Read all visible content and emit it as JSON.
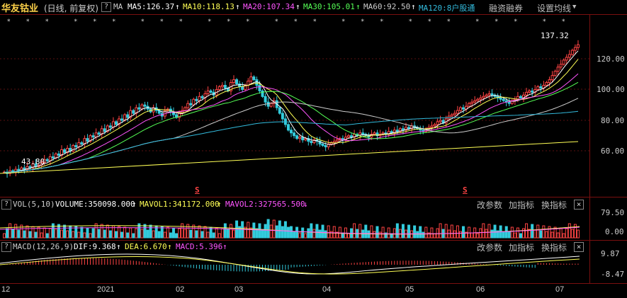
{
  "header": {
    "stock_name": "华友钴业",
    "period": "(日线, 前复权)",
    "help": "?",
    "ma_label": "MA",
    "ma5": {
      "text": "MA5:126.37",
      "color": "#ffffff"
    },
    "ma10": {
      "text": "MA10:118.13",
      "color": "#ffff55"
    },
    "ma20": {
      "text": "MA20:107.34",
      "color": "#ff55ff"
    },
    "ma30": {
      "text": "MA30:105.01",
      "color": "#55ff55"
    },
    "ma60": {
      "text": "MA60:92.50",
      "color": "#cccccc"
    },
    "ma120": {
      "text": "MA120:8户股通",
      "color": "#33bbdd"
    },
    "financing": "融资融券",
    "settings": "设置均线"
  },
  "price_axis": [
    "120.00",
    "100.00",
    "80.00",
    "60.00"
  ],
  "price_annotations": {
    "high": "137.32",
    "low": "43.80",
    "split_marker": "S"
  },
  "vol_panel": {
    "help": "?",
    "name": "VOL(5,10)",
    "volume": "VOLUME:350098.000",
    "mavol1": "MAVOL1:341172.000",
    "mavol2": "MAVOL2:327565.500",
    "axis": [
      "79.50",
      "0.00"
    ]
  },
  "macd_panel": {
    "help": "?",
    "name": "MACD(12,26,9)",
    "dif": "DIF:9.368",
    "dea": "DEA:6.670",
    "macd": "MACD:5.396",
    "axis": [
      "9.87",
      "-8.47"
    ]
  },
  "panel_buttons": {
    "params": "改参数",
    "add": "加指标",
    "switch": "换指标",
    "close": "×"
  },
  "x_axis": [
    "12",
    "2021",
    "02",
    "03",
    "04",
    "05",
    "06",
    "07"
  ],
  "colors": {
    "up": "#ff4444",
    "down": "#33ccdd",
    "grid": "#7a1010"
  },
  "chart_data": {
    "type": "candlestick",
    "y_range": [
      40,
      140
    ],
    "close": [
      46,
      45,
      47,
      46,
      48,
      47,
      49,
      48,
      50,
      49,
      52,
      50,
      51,
      53,
      55,
      54,
      57,
      56,
      59,
      58,
      62,
      60,
      63,
      61,
      65,
      64,
      67,
      66,
      70,
      68,
      72,
      71,
      74,
      73,
      77,
      75,
      79,
      78,
      82,
      80,
      84,
      83,
      87,
      85,
      90,
      88,
      92,
      91,
      94,
      93,
      91,
      89,
      92,
      90,
      88,
      86,
      90,
      91,
      89,
      87,
      85,
      88,
      90,
      92,
      95,
      94,
      98,
      97,
      100,
      99,
      102,
      104,
      103,
      101,
      105,
      107,
      108,
      106,
      104,
      110,
      112,
      109,
      107,
      105,
      108,
      111,
      114,
      112,
      108,
      104,
      100,
      96,
      93,
      95,
      97,
      92,
      88,
      84,
      80,
      76,
      74,
      72,
      70,
      71,
      69,
      70,
      68,
      67,
      69,
      68,
      66,
      65,
      64,
      66,
      67,
      68,
      69,
      70,
      69,
      71,
      72,
      71,
      73,
      72,
      74,
      73,
      72,
      71,
      73,
      74,
      72,
      73,
      74,
      73,
      75,
      74,
      76,
      75,
      77,
      76,
      78,
      77,
      79,
      78,
      77,
      76,
      75,
      77,
      78,
      79,
      80,
      82,
      83,
      81,
      84,
      86,
      87,
      88,
      90,
      92,
      91,
      93,
      95,
      96,
      97,
      98,
      99,
      100,
      101,
      102,
      101,
      100,
      99,
      98,
      97,
      96,
      95,
      97,
      98,
      100,
      99,
      101,
      103,
      104,
      103,
      105,
      107,
      106,
      108,
      110,
      112,
      115,
      118,
      121,
      123,
      126,
      128,
      130,
      133,
      135,
      137
    ],
    "volume_scale": [
      0,
      79.5
    ],
    "macd_range": [
      -8.47,
      9.87
    ],
    "ma_values_last": {
      "ma5": 126.37,
      "ma10": 118.13,
      "ma20": 107.34,
      "ma30": 105.01,
      "ma60": 92.5
    }
  }
}
